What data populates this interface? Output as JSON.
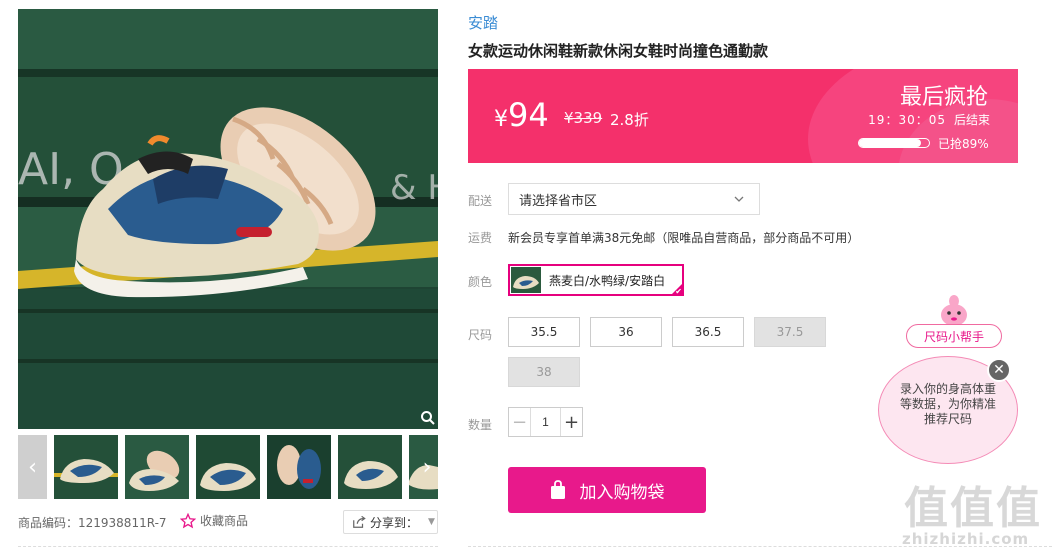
{
  "product": {
    "brand": "安踏",
    "title": "女款运动休闲鞋新款休闲女鞋时尚撞色通勤款"
  },
  "gallery": {
    "thumbnails_count": 6,
    "sku_label": "商品编码：121938811R-7",
    "favorite_label": "收藏商品",
    "share_label": "分享到："
  },
  "price": {
    "currency": "¥",
    "current": "94",
    "original": "¥339",
    "discount": "2.8折"
  },
  "flash_sale": {
    "title": "最后疯抢",
    "countdown": "19：30：05",
    "countdown_suffix": "后结束",
    "sold_percent": 89,
    "sold_label": "已抢89%"
  },
  "labels": {
    "delivery": "配送",
    "shipping": "运费",
    "color": "颜色",
    "size": "尺码",
    "quantity": "数量"
  },
  "delivery": {
    "placeholder": "请选择省市区"
  },
  "shipping": {
    "text": "新会员专享首单满38元免邮（限唯品自营商品，部分商品不可用）"
  },
  "color_option": {
    "name": "燕麦白/水鸭绿/安踏白",
    "selected": true
  },
  "sizes": [
    {
      "label": "35.5",
      "available": true
    },
    {
      "label": "36",
      "available": true
    },
    {
      "label": "36.5",
      "available": true
    },
    {
      "label": "37.5",
      "available": false
    },
    {
      "label": "38",
      "available": false
    }
  ],
  "quantity": {
    "value": "1",
    "minus": "−",
    "plus": "+"
  },
  "cart": {
    "label": "加入购物袋"
  },
  "size_helper": {
    "tag": "尺码小帮手",
    "text": "录入你的身高体重等数据，为你精准推荐尺码"
  },
  "watermark": {
    "logo": "值值值",
    "url": "zhizhizhi.com"
  },
  "colors": {
    "accent": "#e8198b",
    "banner": "#f4306b",
    "link": "#3b8cd4"
  }
}
